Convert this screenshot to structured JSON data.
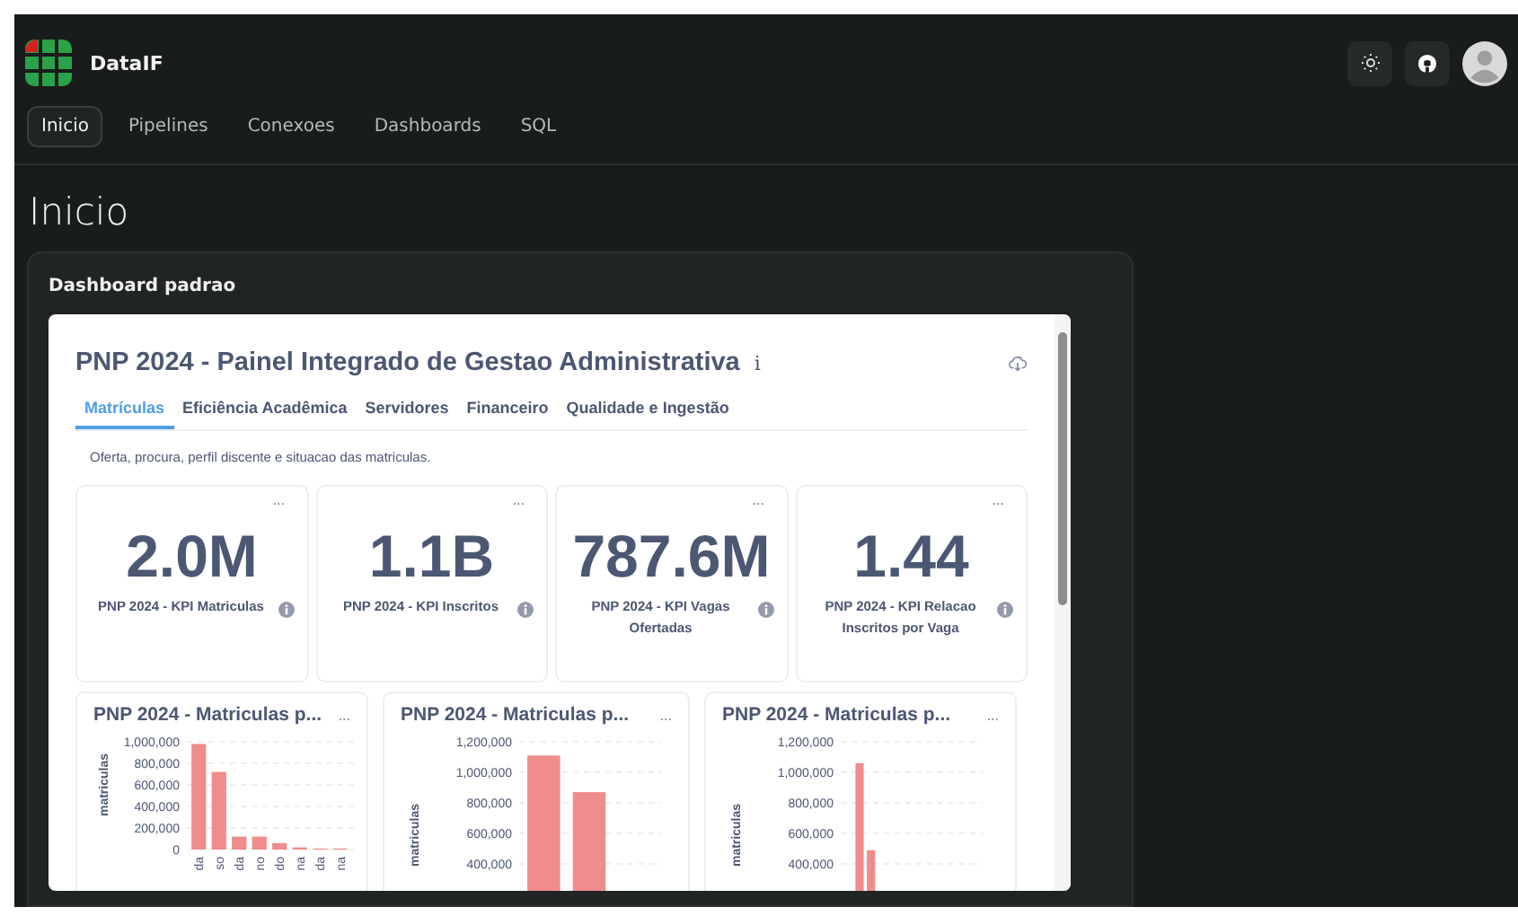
{
  "app": {
    "name": "DataIF"
  },
  "nav": [
    {
      "label": "Inicio",
      "selected": true
    },
    {
      "label": "Pipelines",
      "selected": false
    },
    {
      "label": "Conexoes",
      "selected": false
    },
    {
      "label": "Dashboards",
      "selected": false
    },
    {
      "label": "SQL",
      "selected": false
    }
  ],
  "page_title": "Inicio",
  "panel": {
    "title": "Dashboard padrao",
    "dashboard": {
      "title": "PNP 2024 - Painel Integrado de Gestao Administrativa",
      "info": "i",
      "tabs": [
        {
          "label": "Matrículas",
          "selected": true
        },
        {
          "label": "Eficiência Acadêmica",
          "selected": false
        },
        {
          "label": "Servidores",
          "selected": false
        },
        {
          "label": "Financeiro",
          "selected": false
        },
        {
          "label": "Qualidade e Ingestão",
          "selected": false
        }
      ],
      "description": "Oferta, procura, perfil discente e situacao das matriculas.",
      "kpis": [
        {
          "value": "2.0M",
          "label": "PNP 2024 - KPI Matriculas",
          "menu": "..."
        },
        {
          "value": "1.1B",
          "label": "PNP 2024 - KPI Inscritos",
          "menu": "..."
        },
        {
          "value": "787.6M",
          "label": "PNP 2024 - KPI Vagas Ofertadas",
          "menu": "..."
        },
        {
          "value": "1.44",
          "label": "PNP 2024 - KPI Relacao Inscritos por Vaga",
          "menu": "..."
        }
      ],
      "charts": [
        {
          "title": "PNP 2024 - Matriculas p...",
          "menu": "...",
          "chart_data": {
            "type": "bar",
            "ylabel": "matriculas",
            "categories": [
              "da",
              "so",
              "da",
              "no",
              "do",
              "na",
              "da",
              "na"
            ],
            "grid": true,
            "series": [
              {
                "color": "#ef8c8c",
                "values": [
                  980000,
                  720000,
                  120000,
                  120000,
                  60000,
                  20000,
                  10000,
                  10000
                ]
              }
            ],
            "ylim": [
              0,
              1000000
            ],
            "yticks": [
              {
                "value": 0,
                "label": "0"
              },
              {
                "value": 200000,
                "label": "200,000"
              },
              {
                "value": 400000,
                "label": "400,000"
              },
              {
                "value": 600000,
                "label": "600,000"
              },
              {
                "value": 800000,
                "label": "800,000"
              },
              {
                "value": 1000000,
                "label": "1,000,000"
              }
            ]
          }
        },
        {
          "title": "PNP 2024 - Matriculas p...",
          "menu": "...",
          "chart_data": {
            "type": "bar",
            "ylabel": "matriculas",
            "grid": true,
            "series": [
              {
                "color": "#ef8c8c",
                "values": [
                  1110000,
                  870000,
                  null
                ]
              }
            ],
            "ylim": [
              400000,
              1200000
            ],
            "yticks": [
              {
                "value": 400000,
                "label": "400,000"
              },
              {
                "value": 600000,
                "label": "600,000"
              },
              {
                "value": 800000,
                "label": "800,000"
              },
              {
                "value": 1000000,
                "label": "1,000,000"
              },
              {
                "value": 1200000,
                "label": "1,200,000"
              }
            ]
          }
        },
        {
          "title": "PNP 2024 - Matriculas p...",
          "menu": "...",
          "chart_data": {
            "type": "bar",
            "ylabel": "matriculas",
            "grid": true,
            "series": [
              {
                "color": "#ef8c8c",
                "values": [
                  null,
                  1060000,
                  490000,
                  null,
                  null,
                  null,
                  null,
                  null,
                  null,
                  null,
                  null,
                  null
                ]
              }
            ],
            "ylim": [
              400000,
              1200000
            ],
            "yticks": [
              {
                "value": 400000,
                "label": "400,000"
              },
              {
                "value": 600000,
                "label": "600,000"
              },
              {
                "value": 800000,
                "label": "800,000"
              },
              {
                "value": 1000000,
                "label": "1,000,000"
              },
              {
                "value": 1200000,
                "label": "1,200,000"
              }
            ]
          }
        }
      ]
    }
  }
}
